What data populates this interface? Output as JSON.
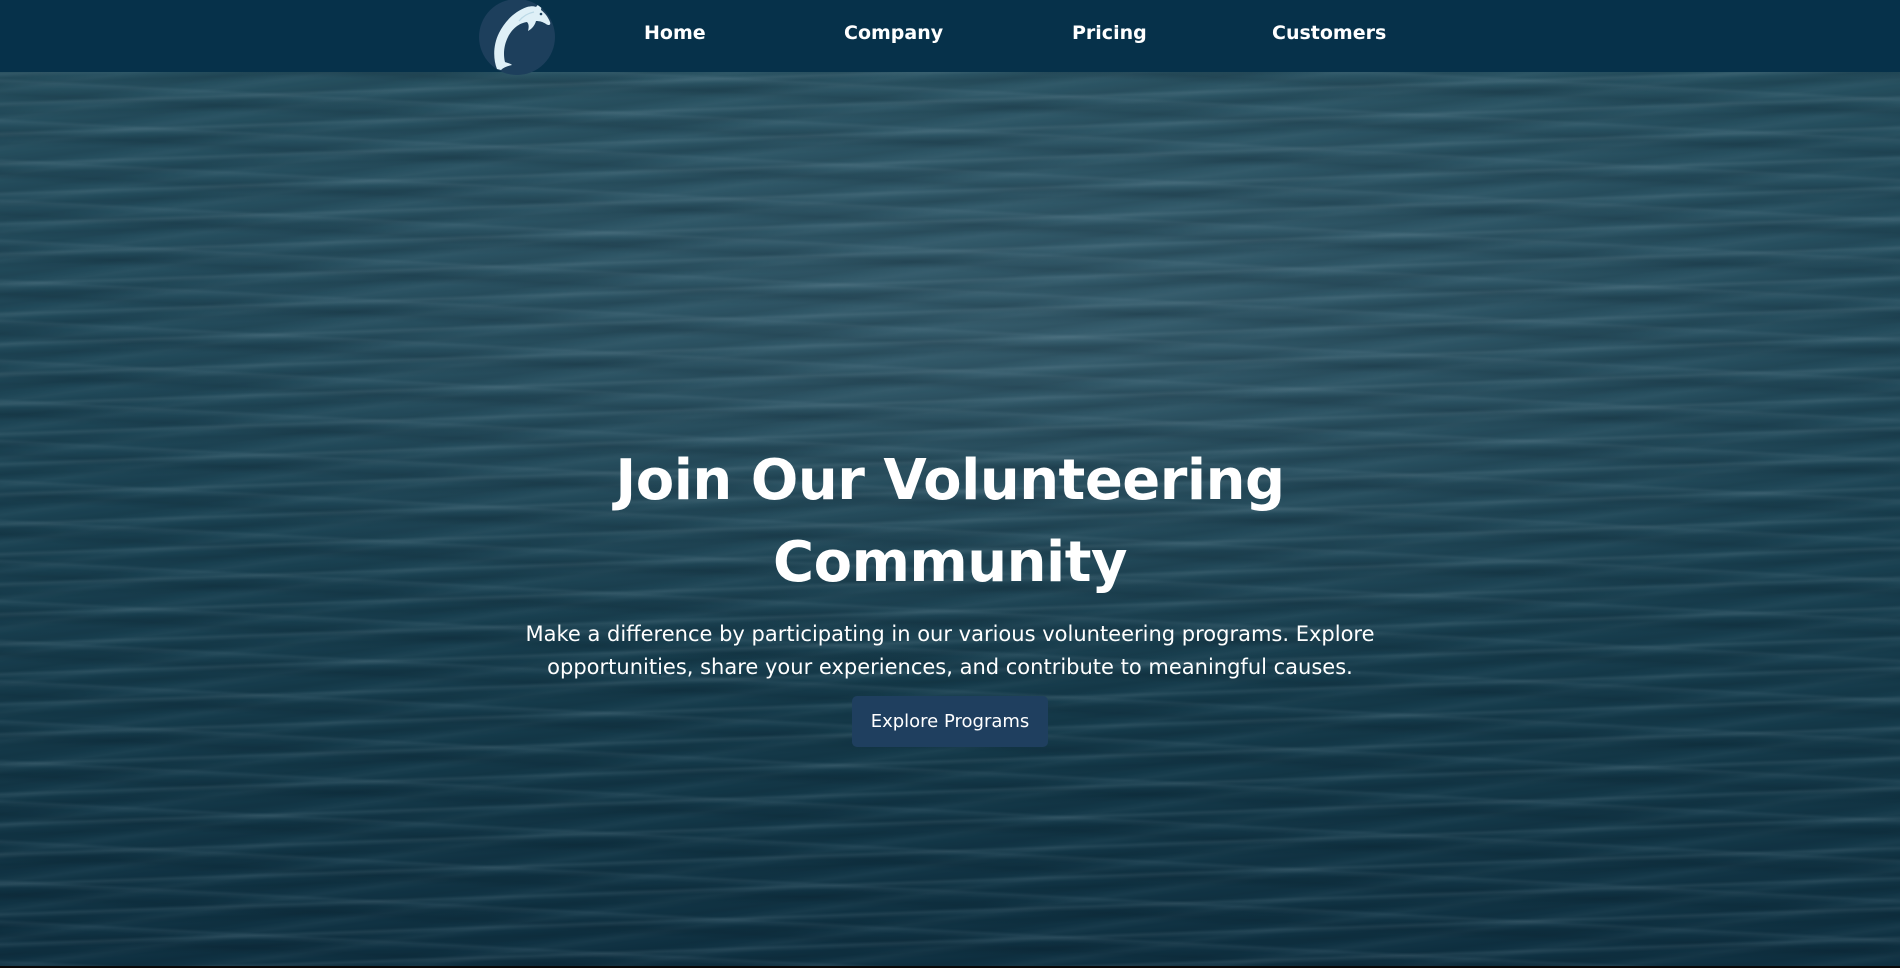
{
  "navbar": {
    "logo_icon": "dolphin-icon",
    "items": [
      {
        "label": "Home"
      },
      {
        "label": "Company"
      },
      {
        "label": "Pricing"
      },
      {
        "label": "Customers"
      }
    ]
  },
  "hero": {
    "background": "ocean-water-image",
    "title": "Join Our Volunteering Community",
    "subtitle": "Make a difference by participating in our various volunteering programs. Explore opportunities, share your experiences, and contribute to meaningful causes.",
    "cta_label": "Explore Programs"
  },
  "colors": {
    "navbar_bg": "#06314a",
    "logo_bg": "#1d3f5c",
    "button_bg": "#1f3f5f",
    "text": "#ffffff"
  }
}
